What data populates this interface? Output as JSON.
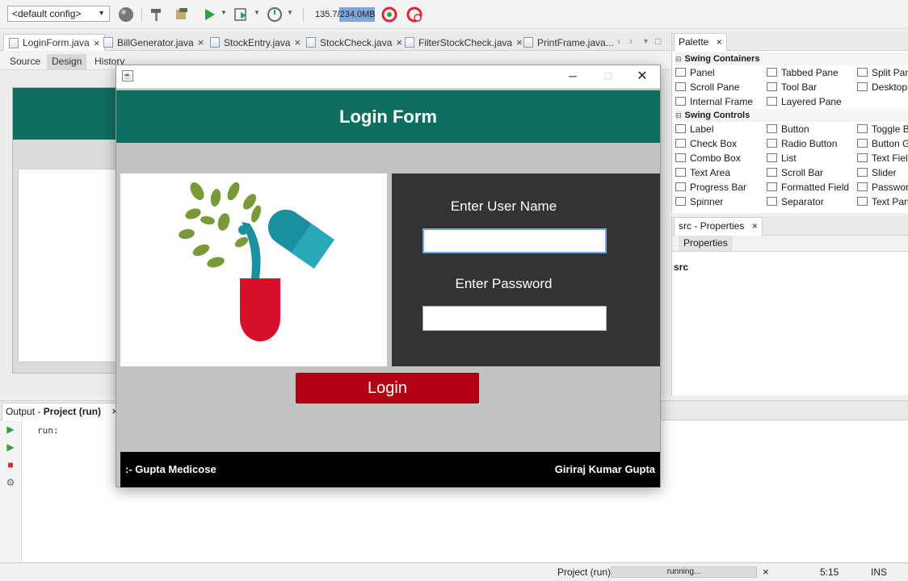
{
  "toolbar": {
    "config": "<default config>",
    "memory": "135.7/234.0MB",
    "memory_used_fraction": 0.58
  },
  "editor_tabs": [
    {
      "label": "LoginForm.java"
    },
    {
      "label": "BillGenerator.java"
    },
    {
      "label": "StockEntry.java"
    },
    {
      "label": "StockCheck.java"
    },
    {
      "label": "FilterStockCheck.java"
    },
    {
      "label": "PrintFrame.java..."
    }
  ],
  "sub_tabs": [
    "Source",
    "Design",
    "History"
  ],
  "palette": {
    "title": "Palette",
    "categories": [
      {
        "name": "Swing Containers",
        "items": [
          "Panel",
          "Tabbed Pane",
          "Split Pane",
          "Scroll Pane",
          "Tool Bar",
          "Desktop P",
          "Internal Frame",
          "Layered Pane"
        ]
      },
      {
        "name": "Swing Controls",
        "items": [
          "Label",
          "Button",
          "Toggle Bu",
          "Check Box",
          "Radio Button",
          "Button Gr",
          "Combo Box",
          "List",
          "Text Field",
          "Text Area",
          "Scroll Bar",
          "Slider",
          "Progress Bar",
          "Formatted Field",
          "Password",
          "Spinner",
          "Separator",
          "Text Pane"
        ]
      }
    ]
  },
  "properties": {
    "tab": "src - Properties",
    "subtab": "Properties",
    "node": "src"
  },
  "output": {
    "tab_prefix": "Output - ",
    "tab_bold": "Project (run)",
    "text": "run:"
  },
  "status": {
    "project": "Project (run)",
    "progress_label": "running...",
    "position": "5:15",
    "mode": "INS"
  },
  "app": {
    "title": "Login Form",
    "username_label": "Enter User Name",
    "username_value": "",
    "password_label": "Enter Password",
    "password_value": "",
    "login_button": "Login",
    "footer_left": ":- Gupta Medicose",
    "footer_right": "Giriraj Kumar Gupta",
    "colors": {
      "header": "#0e6f5e",
      "login_panel": "#333333",
      "button": "#b00012",
      "footer": "#000000",
      "background": "#c2c2c2"
    }
  }
}
